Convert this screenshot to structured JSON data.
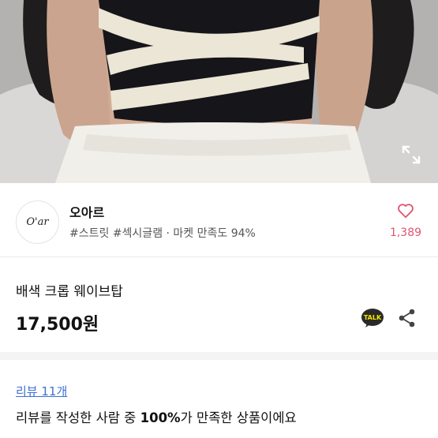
{
  "colors": {
    "accent_link": "#3d6fd6",
    "like_pink": "#e0566f",
    "kakao_yellow": "#f7e600"
  },
  "hero": {
    "expand_icon": "expand-arrows-icon"
  },
  "shop": {
    "logo_text": "O'ar",
    "name": "오아르",
    "tags": "#스트릿 #섹시글램 · 마켓 만족도 94%",
    "like_icon": "heart-outline-icon",
    "like_count": "1,389"
  },
  "product": {
    "name": "배색 크롭 웨이브탑",
    "price": "17,500원",
    "talk_label": "TALK",
    "share_icon": "share-icon"
  },
  "reviews": {
    "link_label": "리뷰 11개",
    "summary_prefix": "리뷰를 작성한 사람 중 ",
    "summary_percent": "100%",
    "summary_suffix": "가 만족한 상품이에요"
  }
}
